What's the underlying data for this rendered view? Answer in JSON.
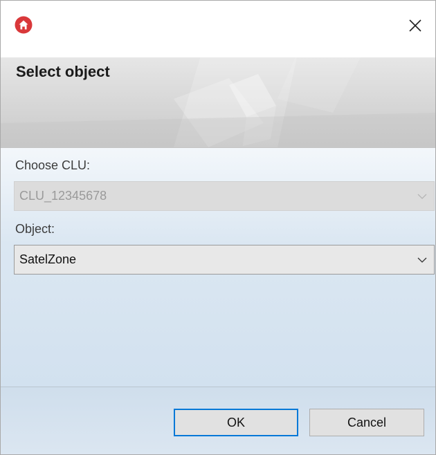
{
  "window": {
    "app_icon": "home-icon",
    "close_icon": "close-icon",
    "banner_title": "Select object"
  },
  "form": {
    "clu_label": "Choose CLU:",
    "clu_value": "CLU_12345678",
    "object_label": "Object:",
    "object_value": "SatelZone"
  },
  "buttons": {
    "ok": "OK",
    "cancel": "Cancel"
  },
  "colors": {
    "accent": "#0078d7",
    "app_icon_red": "#d9383a"
  }
}
